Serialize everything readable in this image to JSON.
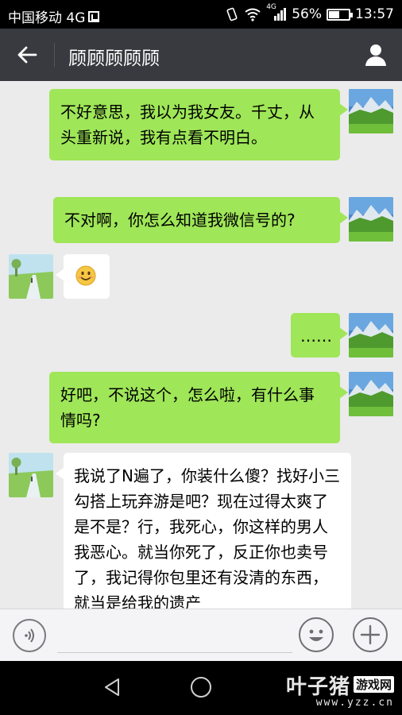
{
  "status_bar": {
    "carrier": "中国移动 4G",
    "network_small": "4G",
    "battery_text": "56%",
    "battery_level": 0.56,
    "time": "13:57"
  },
  "header": {
    "title": "顾顾顾顾顾"
  },
  "messages": [
    {
      "sender": "me",
      "text": "不好意思，我以为我女友。千丈，从头重新说，我有点看不明白。"
    },
    {
      "sender": "me",
      "text": "不对啊，你怎么知道我微信号的?"
    },
    {
      "sender": "friend",
      "type": "emoji",
      "emoji": "smile-emoji"
    },
    {
      "sender": "me",
      "text": "……"
    },
    {
      "sender": "me",
      "text": "好吧，不说这个，怎么啦，有什么事情吗?"
    },
    {
      "sender": "friend",
      "text": "我说了N遍了，你装什么傻？找好小三勾搭上玩弃游是吧？现在过得太爽了是不是？行，我死心，你这样的男人我恶心。就当你死了，反正你也卖号了，我记得你包里还有没清的东西，就当是给我的遗产"
    }
  ],
  "input_bar": {
    "placeholder": "",
    "icons": [
      "voice-icon",
      "emoji-icon",
      "plus-icon"
    ]
  },
  "nav_bar": {
    "icons": [
      "back-triangle-icon",
      "home-circle-icon"
    ]
  },
  "watermark": {
    "brand": "叶子猪",
    "badge": "游戏网",
    "url": "www.yzz.cn"
  },
  "colors": {
    "my_bubble": "#9fe658",
    "friend_bubble": "#ffffff",
    "header_bg": "#393a3f",
    "chat_bg": "#ebebeb"
  }
}
